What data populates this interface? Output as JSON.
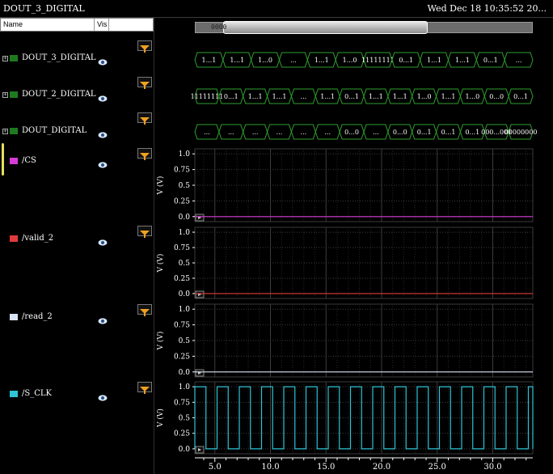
{
  "window": {
    "title": "DOUT_3_DIGITAL",
    "timestamp": "Wed Dec 18 10:35:52 20...",
    "corner": "1"
  },
  "header": {
    "name_col": "Name",
    "vis_col": "Vis"
  },
  "signals": [
    {
      "name": "DOUT_3_DIGITAL",
      "type": "bus",
      "color": "#1f7a1f",
      "segments": [
        "1...1",
        "1...1",
        "1...0",
        "...",
        "1...1",
        "1...0",
        "11111111",
        "0...1",
        "1...1",
        "1...1",
        "0...1",
        "..."
      ]
    },
    {
      "name": "DOUT_2_DIGITAL",
      "type": "bus",
      "color": "#1f7a1f",
      "segments": [
        "11111111",
        "0...1",
        "1...1",
        "1...1",
        "...",
        "1...1",
        "0...1",
        "1...1",
        "1...1",
        "1...0",
        "1...1",
        "1...0",
        "0...0",
        "0...1"
      ]
    },
    {
      "name": "DOUT_DIGITAL",
      "type": "bus",
      "color": "#1f7a1f",
      "segments": [
        "...",
        "...",
        "...",
        "...",
        "...",
        "...",
        "0...0",
        "...",
        "0...0",
        "0...1",
        "0...1",
        "0...1",
        "000...001",
        "00000000"
      ]
    },
    {
      "name": "/CS",
      "type": "analog",
      "color": "#d63bd6",
      "ylabel": "V (V)",
      "value": 0.0
    },
    {
      "name": "/valid_2",
      "type": "analog",
      "color": "#e03a3a",
      "ylabel": "V (V)",
      "value": 0.0
    },
    {
      "name": "/read_2",
      "type": "analog",
      "color": "#d8e4f6",
      "ylabel": "V (V)",
      "value": 0.0
    },
    {
      "name": "/S_CLK",
      "type": "analog",
      "color": "#2ec4d6",
      "ylabel": "V (V)",
      "clock": true
    }
  ],
  "scroll_value": "0000",
  "chart_data": {
    "type": "line",
    "xlabel": "",
    "x_ticks": [
      "5.0",
      "10.0",
      "15.0",
      "20.0",
      "25.0",
      "30.0"
    ],
    "xlim": [
      3.2,
      33.6
    ],
    "ylim": [
      -0.08,
      1.08
    ],
    "y_ticks": [
      "0.0",
      "0.25",
      "0.5",
      "0.75",
      "1.0"
    ],
    "grid": true,
    "series": [
      {
        "name": "/CS",
        "points": [
          [
            3.2,
            0.0
          ],
          [
            33.6,
            0.0
          ]
        ]
      },
      {
        "name": "/valid_2",
        "points": [
          [
            3.2,
            0.0
          ],
          [
            33.6,
            0.0
          ]
        ]
      },
      {
        "name": "/read_2",
        "points": [
          [
            3.2,
            0.0
          ],
          [
            33.6,
            0.0
          ]
        ]
      },
      {
        "name": "/S_CLK",
        "clock_period": 2.0,
        "rise_start": 3.2,
        "high": 1.0,
        "low": 0.0,
        "duty": 0.5
      }
    ]
  }
}
